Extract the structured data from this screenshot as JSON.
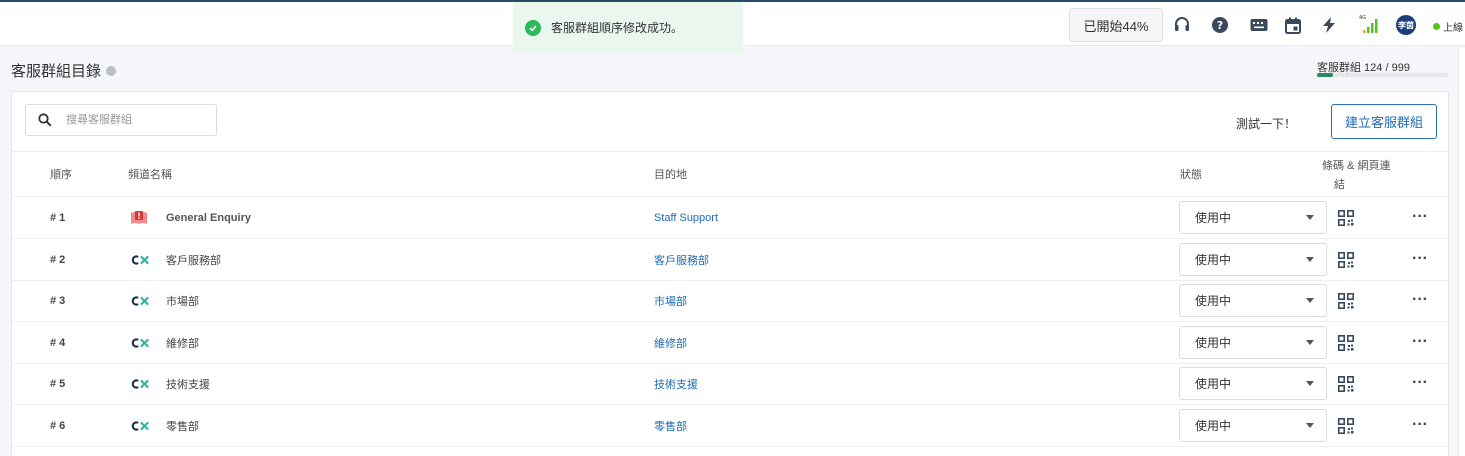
{
  "toast": {
    "message": "客服群組順序修改成功。"
  },
  "topbar": {
    "started_label": "已開始44%",
    "avatar_text": "李茵",
    "signal_label": "4G",
    "online_label": "上線"
  },
  "page": {
    "title": "客服群組目錄",
    "quota_label": "客服群組 124 / 999",
    "quota_fraction": 0.124
  },
  "toolbar": {
    "search_placeholder": "搜尋客服群組",
    "test_label": "測試一下！",
    "create_label": "建立客服群組"
  },
  "table": {
    "headers": {
      "order": "順序",
      "channel_name": "頻道名稱",
      "destination": "目的地",
      "status": "狀態",
      "barcode_line1": "條碼 & 網頁連",
      "barcode_line2": "結"
    },
    "rows": [
      {
        "order": "# 1",
        "icon": "alert-book-icon",
        "name": "General Enquiry",
        "destination": "Staff Support",
        "status": "使用中"
      },
      {
        "order": "# 2",
        "icon": "cx-logo-icon",
        "name": "客戶服務部",
        "destination": "客戶服務部",
        "status": "使用中"
      },
      {
        "order": "# 3",
        "icon": "cx-logo-icon",
        "name": "市場部",
        "destination": "市場部",
        "status": "使用中"
      },
      {
        "order": "# 4",
        "icon": "cx-logo-icon",
        "name": "維修部",
        "destination": "維修部",
        "status": "使用中"
      },
      {
        "order": "# 5",
        "icon": "cx-logo-icon",
        "name": "技術支援",
        "destination": "技術支援",
        "status": "使用中"
      },
      {
        "order": "# 6",
        "icon": "cx-logo-icon",
        "name": "零售部",
        "destination": "零售部",
        "status": "使用中"
      }
    ]
  },
  "colors": {
    "accent": "#1f6bb5",
    "success": "#2eb85c",
    "quota": "#2a8a5e"
  }
}
